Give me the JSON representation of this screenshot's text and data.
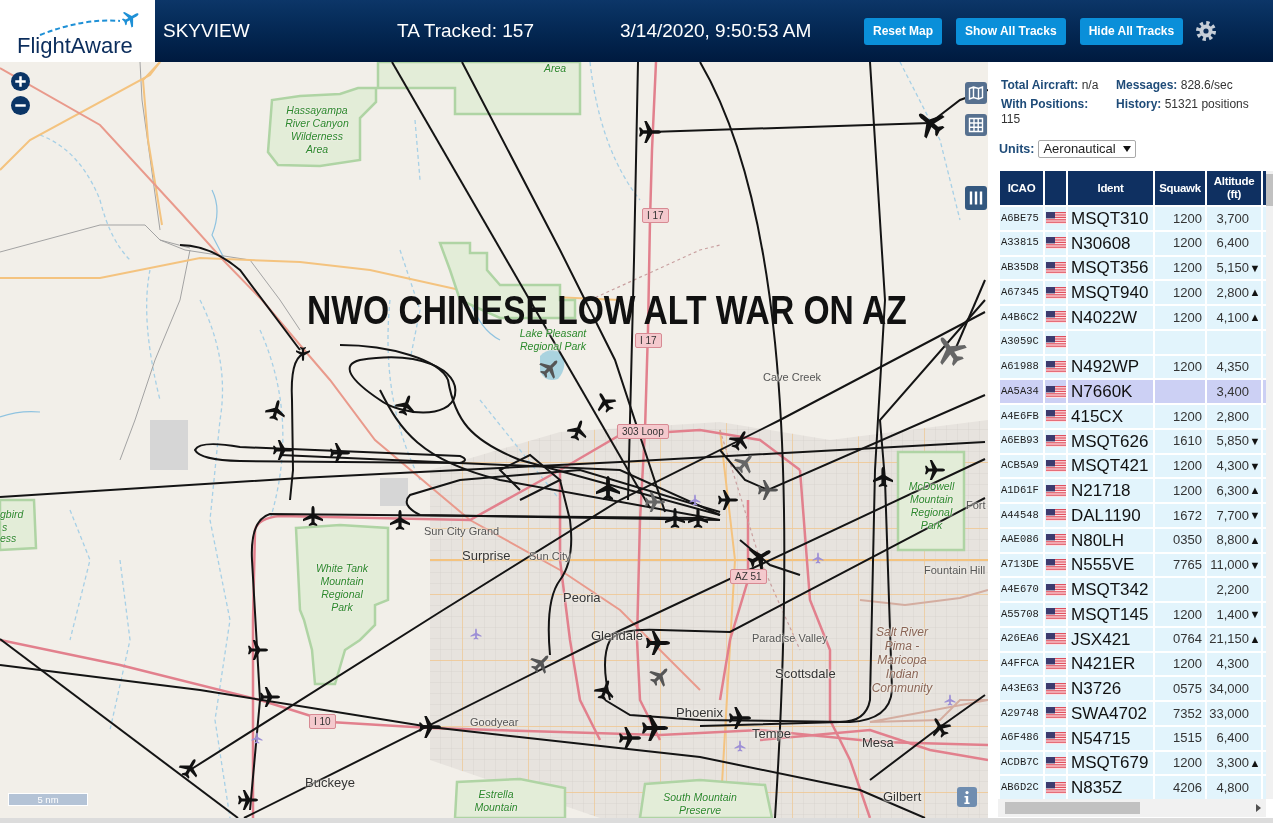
{
  "header": {
    "logo": "FlightAware",
    "title": "SKYVIEW",
    "tracked": "TA Tracked: 157",
    "datetime": "3/14/2020, 9:50:53 AM",
    "buttons": [
      "Reset Map",
      "Show All Tracks",
      "Hide All Tracks"
    ]
  },
  "map": {
    "overlay_text": "NWO CHINESE LOW ALT WAR ON AZ",
    "labels": [
      {
        "kind": "park",
        "text": "Area"
      },
      {
        "kind": "park",
        "text": "Hassayampa River Canyon Wilderness Area"
      },
      {
        "kind": "shield",
        "text": "I 17"
      },
      {
        "kind": "park",
        "text": "Lake Pleasant Regional Park"
      },
      {
        "kind": "shield",
        "text": "I 17"
      },
      {
        "kind": "town",
        "text": "Cave Creek"
      },
      {
        "kind": "shield",
        "text": "303 Loop"
      },
      {
        "kind": "park",
        "text": "McDowell Mountain Regional Park"
      },
      {
        "kind": "town",
        "text": "Fort"
      },
      {
        "kind": "park",
        "text": "gbird"
      },
      {
        "kind": "park",
        "text": "s"
      },
      {
        "kind": "park",
        "text": "ess"
      },
      {
        "kind": "town",
        "text": "Sun City Grand"
      },
      {
        "kind": "city",
        "text": "Surprise"
      },
      {
        "kind": "town",
        "text": "Sun City"
      },
      {
        "kind": "town",
        "text": "Fountain Hill"
      },
      {
        "kind": "park",
        "text": "White Tank Mountain Regional Park"
      },
      {
        "kind": "shield",
        "text": "AZ 51"
      },
      {
        "kind": "city",
        "text": "Peoria"
      },
      {
        "kind": "city",
        "text": "Glendale"
      },
      {
        "kind": "town",
        "text": "Paradise Valley"
      },
      {
        "kind": "reserve",
        "text": "Salt River Pima - Maricopa Indian Community"
      },
      {
        "kind": "city",
        "text": "Scottsdale"
      },
      {
        "kind": "city",
        "text": "Phoenix"
      },
      {
        "kind": "shield",
        "text": "I 10"
      },
      {
        "kind": "town",
        "text": "Goodyear"
      },
      {
        "kind": "city",
        "text": "Tempe"
      },
      {
        "kind": "city",
        "text": "Mesa"
      },
      {
        "kind": "city",
        "text": "Buckeye"
      },
      {
        "kind": "park",
        "text": "Estrella Mountain"
      },
      {
        "kind": "park",
        "text": "South Mountain Preserve"
      },
      {
        "kind": "city",
        "text": "Gilbert"
      }
    ],
    "scale": "5 nm"
  },
  "sidebar": {
    "stats": [
      {
        "label": "Total Aircraft:",
        "value": "n/a"
      },
      {
        "label": "Messages:",
        "value": "828.6/sec"
      },
      {
        "label": "With Positions:",
        "value": "115"
      },
      {
        "label": "History:",
        "value": "51321 positions"
      }
    ],
    "units": {
      "label": "Units:",
      "value": "Aeronautical"
    },
    "table": {
      "columns": [
        "ICAO",
        "Ident",
        "Squawk",
        "Altitude (ft)"
      ],
      "rows": [
        {
          "icao": "A6BE75",
          "ident": "MSQT310",
          "squawk": "1200",
          "altitude": "3,700",
          "selected": false
        },
        {
          "icao": "A33815",
          "ident": "N30608",
          "squawk": "1200",
          "altitude": "6,400",
          "selected": false
        },
        {
          "icao": "AB35D8",
          "ident": "MSQT356",
          "squawk": "1200",
          "altitude": "5,150",
          "trend": "▼",
          "selected": false
        },
        {
          "icao": "A67345",
          "ident": "MSQT940",
          "squawk": "1200",
          "altitude": "2,800",
          "trend": "▲",
          "selected": false
        },
        {
          "icao": "A4B6C2",
          "ident": "N4022W",
          "squawk": "1200",
          "altitude": "4,100",
          "trend": "▲",
          "selected": false
        },
        {
          "icao": "A3059C",
          "selected": false
        },
        {
          "icao": "A61988",
          "ident": "N492WP",
          "squawk": "1200",
          "altitude": "4,350",
          "selected": false
        },
        {
          "icao": "AA5A34",
          "ident": "N7660K",
          "altitude": "3,400",
          "selected": true
        },
        {
          "icao": "A4E6FB",
          "ident": "415CX",
          "squawk": "1200",
          "altitude": "2,800",
          "selected": false
        },
        {
          "icao": "A6EB93",
          "ident": "MSQT626",
          "squawk": "1610",
          "altitude": "5,850",
          "trend": "▼",
          "selected": false
        },
        {
          "icao": "ACB5A9",
          "ident": "MSQT421",
          "squawk": "1200",
          "altitude": "4,300",
          "trend": "▼",
          "selected": false
        },
        {
          "icao": "A1D61F",
          "ident": "N21718",
          "squawk": "1200",
          "altitude": "6,300",
          "trend": "▲",
          "selected": false
        },
        {
          "icao": "A44548",
          "ident": "DAL1190",
          "squawk": "1672",
          "altitude": "7,700",
          "trend": "▼",
          "selected": false
        },
        {
          "icao": "AAE086",
          "ident": "N80LH",
          "squawk": "0350",
          "altitude": "8,800",
          "trend": "▲",
          "selected": false
        },
        {
          "icao": "A713DE",
          "ident": "N555VE",
          "squawk": "7765",
          "altitude": "11,000",
          "trend": "▼",
          "selected": false
        },
        {
          "icao": "A4E670",
          "ident": "MSQT342",
          "altitude": "2,200",
          "selected": false
        },
        {
          "icao": "A55708",
          "ident": "MSQT145",
          "squawk": "1200",
          "altitude": "1,400",
          "trend": "▼",
          "selected": false
        },
        {
          "icao": "A26EA6",
          "ident": "JSX421",
          "squawk": "0764",
          "altitude": "21,150",
          "trend": "▲",
          "selected": false
        },
        {
          "icao": "A4FFCA",
          "ident": "N421ER",
          "squawk": "1200",
          "altitude": "4,300",
          "selected": false
        },
        {
          "icao": "A43E63",
          "ident": "N3726",
          "squawk": "0575",
          "altitude": "34,000",
          "selected": false
        },
        {
          "icao": "A29748",
          "ident": "SWA4702",
          "squawk": "7352",
          "altitude": "33,000",
          "selected": false
        },
        {
          "icao": "A6F486",
          "ident": "N54715",
          "squawk": "1515",
          "altitude": "6,400",
          "selected": false
        },
        {
          "icao": "ACDB7C",
          "ident": "MSQT679",
          "squawk": "1200",
          "altitude": "3,300",
          "trend": "▲",
          "selected": false
        },
        {
          "icao": "AB6D2C",
          "ident": "N835Z",
          "squawk": "4206",
          "altitude": "4,800",
          "selected": false
        }
      ]
    }
  }
}
